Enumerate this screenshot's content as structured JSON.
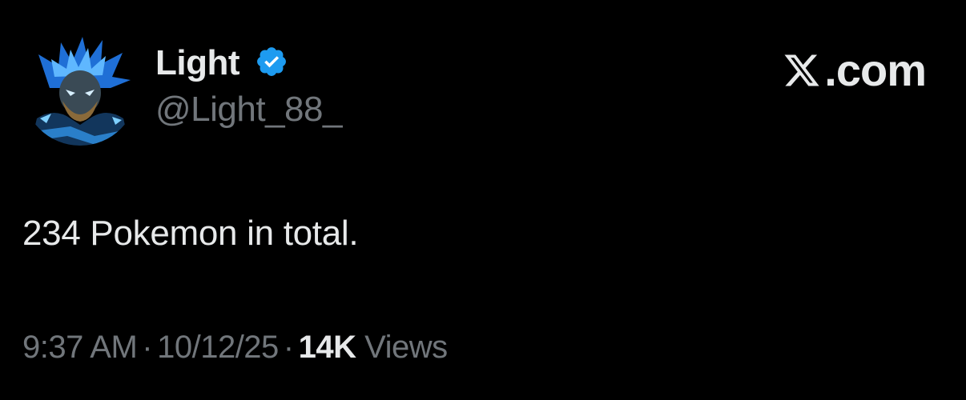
{
  "author": {
    "display_name": "Light",
    "handle": "@Light_88_",
    "verified_icon": "verified-badge-icon",
    "avatar_icon": "avatar-image"
  },
  "brand": {
    "logo_icon": "x-logo-icon",
    "label": ".com"
  },
  "tweet": {
    "text": "234 Pokemon in total."
  },
  "meta": {
    "time": "9:37 AM",
    "separator": "·",
    "date": "10/12/25",
    "views_count": "14K",
    "views_label": "Views"
  },
  "colors": {
    "background": "#000000",
    "primary_text": "#e7e9ea",
    "secondary_text": "#71767b",
    "verified_blue": "#1d9bf0"
  }
}
